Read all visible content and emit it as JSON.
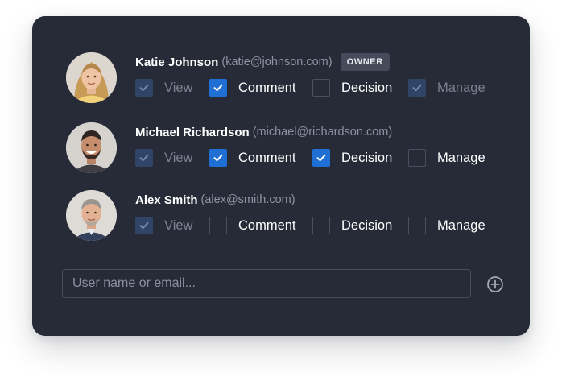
{
  "users": [
    {
      "name": "Katie Johnson",
      "email": "(katie@johnson.com)",
      "badge": "OWNER",
      "avatar": "avatar-woman-blonde",
      "permissions": [
        {
          "label": "View",
          "state": "disabled-checked"
        },
        {
          "label": "Comment",
          "state": "checked"
        },
        {
          "label": "Decision",
          "state": "unchecked"
        },
        {
          "label": "Manage",
          "state": "disabled-checked"
        }
      ]
    },
    {
      "name": "Michael Richardson",
      "email": "(michael@richardson.com)",
      "avatar": "avatar-man-smiling",
      "permissions": [
        {
          "label": "View",
          "state": "disabled-checked"
        },
        {
          "label": "Comment",
          "state": "checked"
        },
        {
          "label": "Decision",
          "state": "checked"
        },
        {
          "label": "Manage",
          "state": "unchecked"
        }
      ]
    },
    {
      "name": "Alex Smith",
      "email": "(alex@smith.com)",
      "avatar": "avatar-man-gray-hair",
      "permissions": [
        {
          "label": "View",
          "state": "disabled-checked"
        },
        {
          "label": "Comment",
          "state": "unchecked"
        },
        {
          "label": "Decision",
          "state": "unchecked"
        },
        {
          "label": "Manage",
          "state": "unchecked"
        }
      ]
    }
  ],
  "add_user": {
    "placeholder": "User name or email...",
    "value": "",
    "button_icon": "plus-circle-icon"
  },
  "colors": {
    "card_background": "#262b37",
    "checkbox_checked": "#1f6fd4",
    "checkbox_disabled": "#2f4466",
    "badge_background": "#454b5a"
  }
}
